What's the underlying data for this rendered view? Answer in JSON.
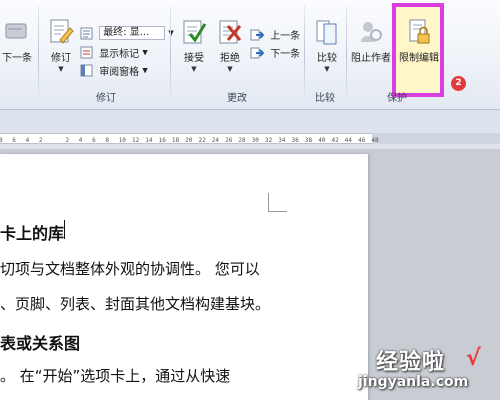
{
  "ribbon": {
    "prev_label": "下一条",
    "tracking": {
      "track_changes_label": "修订",
      "final_show_markup": "最终: 显...",
      "show_markup": "显示标记",
      "reviewing_pane": "审阅窗格",
      "group_label": "修订"
    },
    "changes": {
      "accept_label": "接受",
      "reject_label": "拒绝",
      "previous_label": "上一条",
      "next_label": "下一条",
      "group_label": "更改"
    },
    "compare": {
      "compare_label": "比较",
      "group_label": "比较"
    },
    "protect": {
      "block_authors_label": "阻止作者",
      "restrict_editing_label": "限制编辑",
      "group_label": "保护"
    },
    "badge": "2"
  },
  "ruler": {
    "ticks": [
      "8",
      "6",
      "4",
      "2",
      "",
      "2",
      "4",
      "6",
      "8",
      "10",
      "12",
      "14",
      "16",
      "18",
      "20",
      "22",
      "24",
      "26",
      "28",
      "30",
      "32",
      "34",
      "36",
      "38",
      "40",
      "42",
      "44",
      "46",
      "48"
    ]
  },
  "document": {
    "heading1": "卡上的库",
    "line1": "切项与文档整体外观的协调性。 您可以",
    "line2": "、页脚、列表、封面其他文档构建基块。",
    "heading2": "表或关系图",
    "line3": "。 在“开始”选项卡上，通过从快速"
  },
  "watermark": {
    "title": "经验啦",
    "check": "√",
    "url": "jingyanla.com"
  },
  "colors": {
    "highlight_border": "#d93fe0",
    "badge": "#e23b3b"
  }
}
